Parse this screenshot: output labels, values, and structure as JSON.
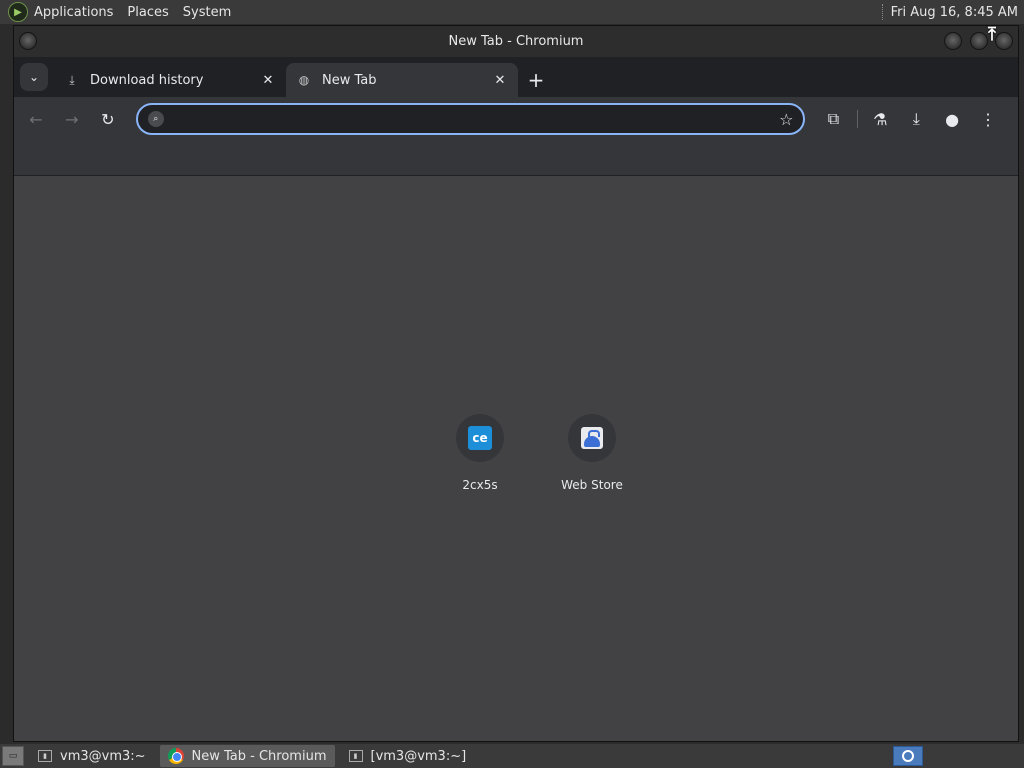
{
  "top_panel": {
    "menu": [
      "Applications",
      "Places",
      "System"
    ],
    "clock": "Fri Aug 16,  8:45 AM"
  },
  "window": {
    "title": "New Tab - Chromium"
  },
  "tabs": [
    {
      "title": "Download history",
      "icon": "download-icon",
      "active": false
    },
    {
      "title": "New Tab",
      "icon": "globe-icon",
      "active": true
    }
  ],
  "omnibox": {
    "value": "",
    "placeholder": ""
  },
  "shortcuts": [
    {
      "label": "2cx5s",
      "icon": "ce-logo",
      "icon_text": "ce"
    },
    {
      "label": "Web Store",
      "icon": "web-store-icon"
    }
  ],
  "taskbar": {
    "tasks": [
      {
        "label": "vm3@vm3:~",
        "icon": "terminal-icon",
        "active": false
      },
      {
        "label": "New Tab - Chromium",
        "icon": "chromium-icon",
        "active": true
      },
      {
        "label": "[vm3@vm3:~]",
        "icon": "terminal-icon",
        "active": false
      }
    ]
  },
  "colors": {
    "accent": "#8ab4f8",
    "content_bg": "#424245",
    "toolbar_bg": "#35363a",
    "frame_bg": "#202124"
  }
}
